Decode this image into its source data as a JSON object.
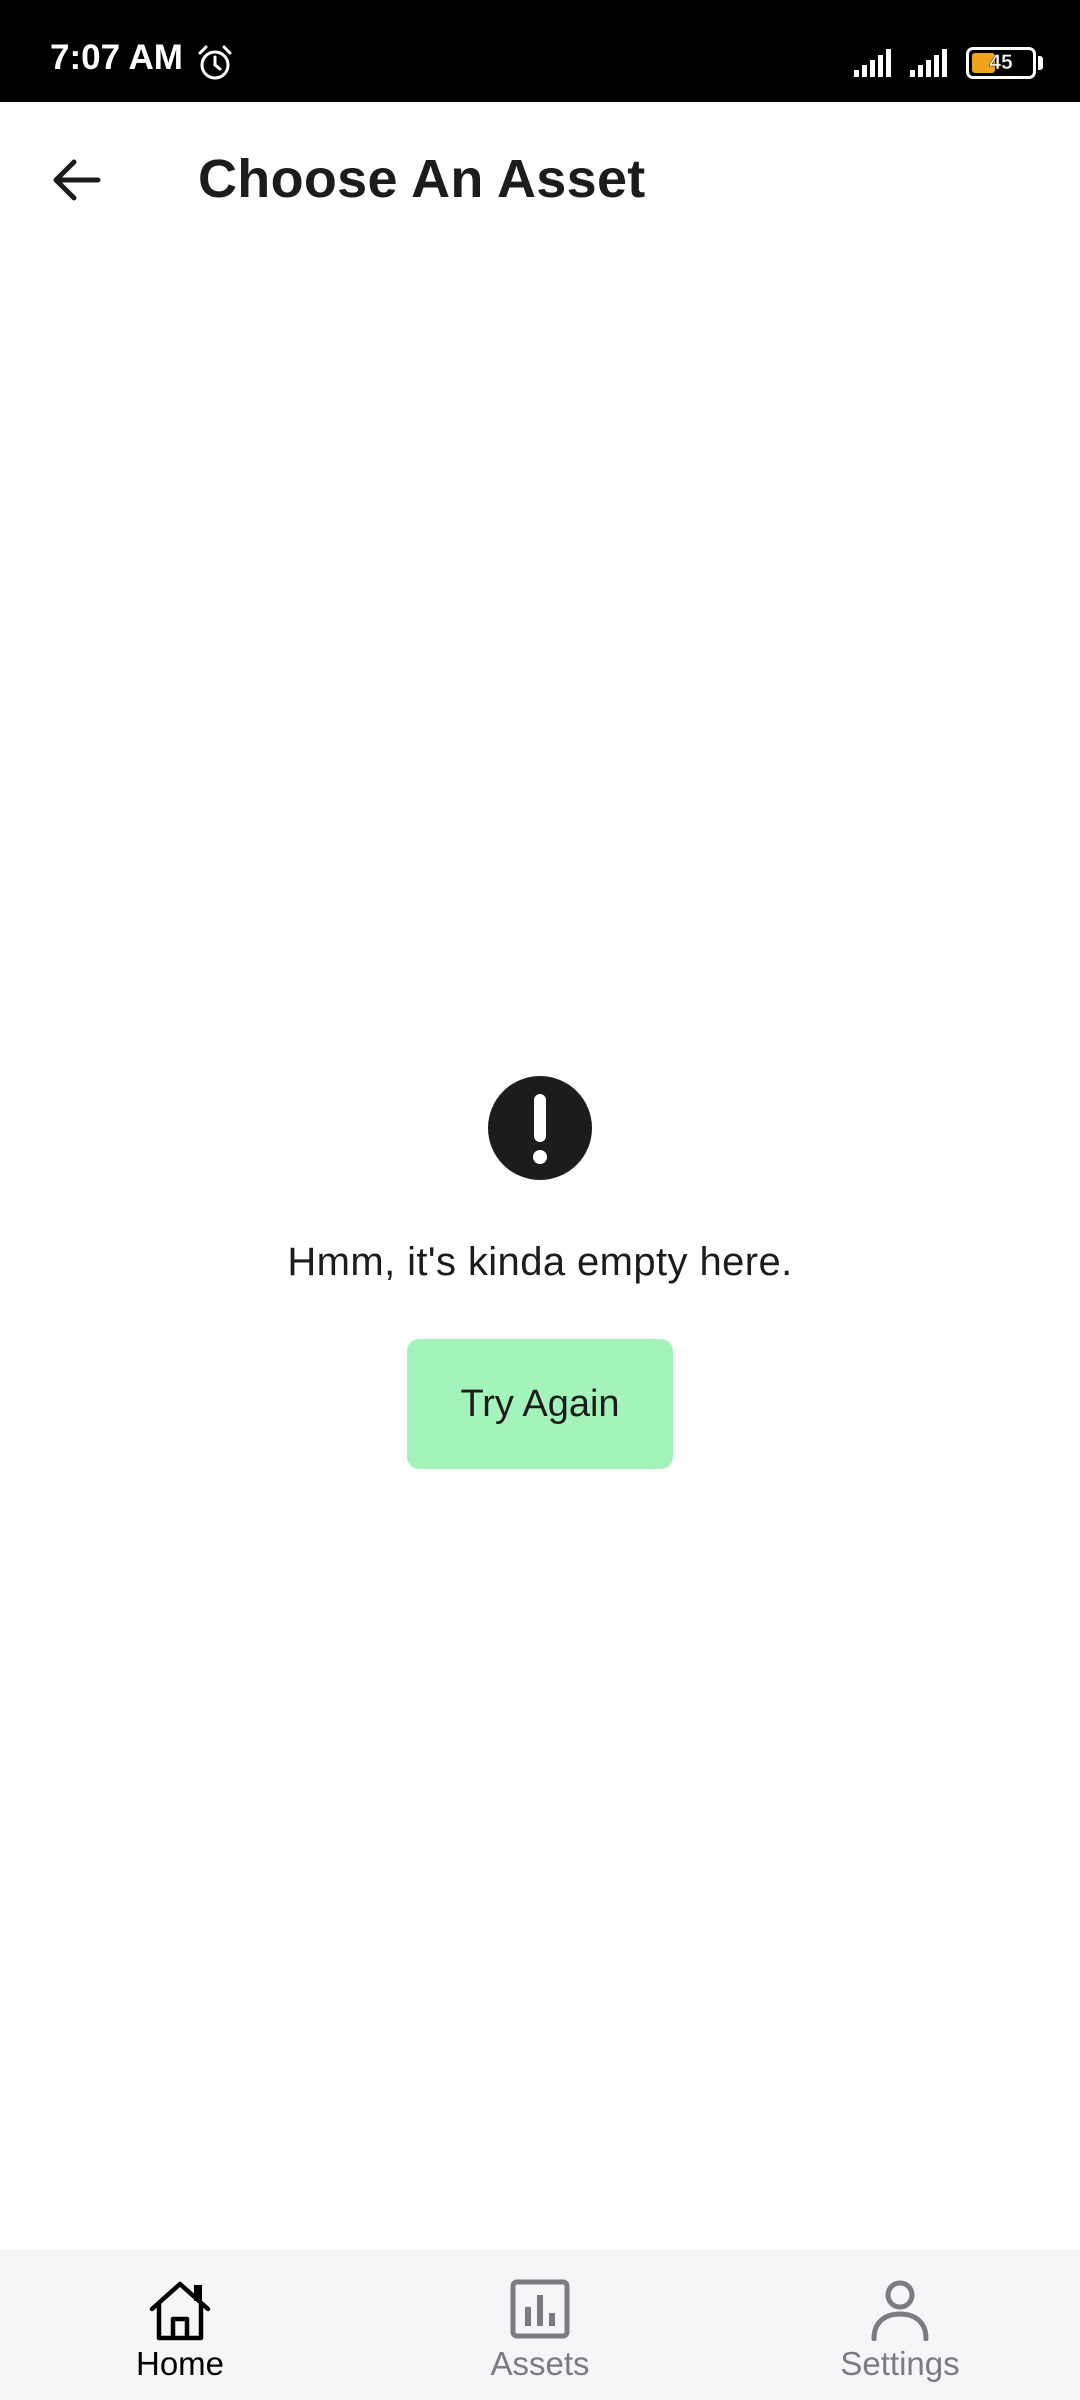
{
  "status_bar": {
    "time": "7:07 AM",
    "battery_level": "45",
    "battery_fill_fraction": 0.45,
    "battery_color": "#f0a31c",
    "icons": [
      "alarm-icon",
      "signal-icon",
      "signal-icon",
      "battery-icon"
    ]
  },
  "header": {
    "back_icon": "arrow-left-icon",
    "title": "Choose An Asset"
  },
  "empty_state": {
    "icon": "exclamation-circle-icon",
    "message": "Hmm, it's kinda empty here.",
    "button_label": "Try Again",
    "button_color": "#a3f3bb"
  },
  "bottom_nav": {
    "active_index": 0,
    "items": [
      {
        "label": "Home",
        "icon": "home-icon"
      },
      {
        "label": "Assets",
        "icon": "bar-chart-icon"
      },
      {
        "label": "Settings",
        "icon": "user-icon"
      }
    ]
  }
}
